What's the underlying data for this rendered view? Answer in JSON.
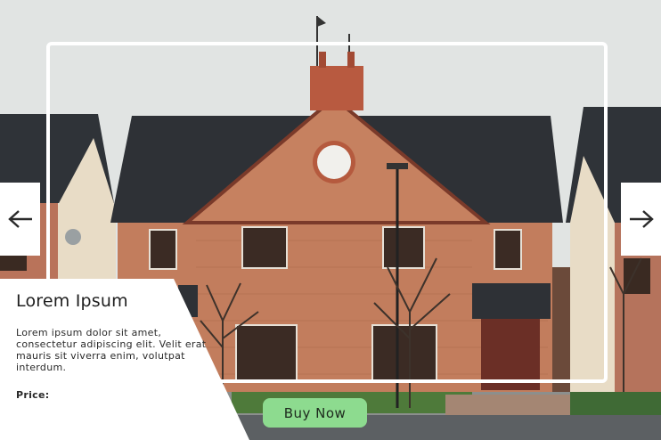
{
  "card": {
    "title": "Lorem Ipsum",
    "description": "Lorem ipsum dolor sit amet, consectetur adipiscing elit. Velit erat mauris sit viverra enim, volutpat interdum.",
    "price_label": "Price:"
  },
  "buy_button": {
    "label": "Buy Now"
  },
  "nav": {
    "prev_icon": "arrow-left-icon",
    "next_icon": "arrow-right-icon"
  },
  "colors": {
    "button_bg": "#8ddb8f",
    "card_bg": "#ffffff",
    "frame": "#ffffff"
  }
}
